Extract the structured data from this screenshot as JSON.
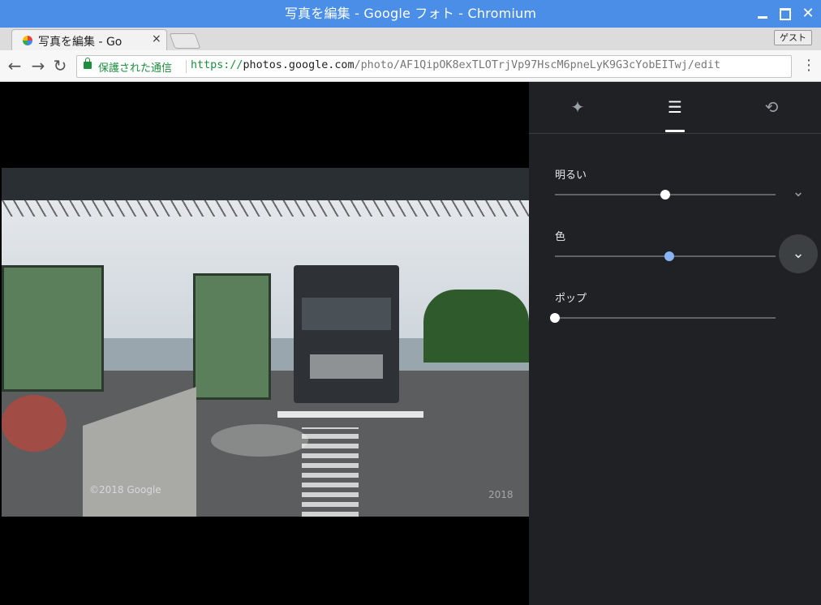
{
  "window": {
    "title": "写真を編集 - Google フォト - Chromium"
  },
  "tab": {
    "title": "写真を編集 - Go",
    "close_glyph": "×"
  },
  "guest_label": "ゲスト",
  "toolbar": {
    "back_glyph": "←",
    "forward_glyph": "→",
    "reload_glyph": "↻",
    "secure_label": "保護された通信",
    "url_scheme": "https://",
    "url_host": "photos.google.com",
    "url_path": "/photo/AF1QipOK8exTLOTrjVp97HscM6pneLyK9G3cYobEITwj/edit",
    "menu_glyph": "⋮"
  },
  "photo": {
    "copyright": "©2018 Google",
    "copyright_right": "2018"
  },
  "editor": {
    "tabs": [
      {
        "icon": "auto-enhance-icon",
        "glyph": "✦"
      },
      {
        "icon": "adjust-sliders-icon",
        "glyph": "☰"
      },
      {
        "icon": "crop-rotate-icon",
        "glyph": "⟲"
      }
    ],
    "active_tab": 1,
    "adjustments": [
      {
        "label": "明るい",
        "value": 0.5
      },
      {
        "label": "色",
        "value": 0.52
      },
      {
        "label": "ポップ",
        "value": 0.0
      }
    ],
    "expand_glyph": "⌄"
  },
  "colors": {
    "titlebar": "#4a8ee8",
    "panel": "#202124",
    "accent_knob": "#8ab4f8",
    "secure_green": "#1e8e3e"
  }
}
